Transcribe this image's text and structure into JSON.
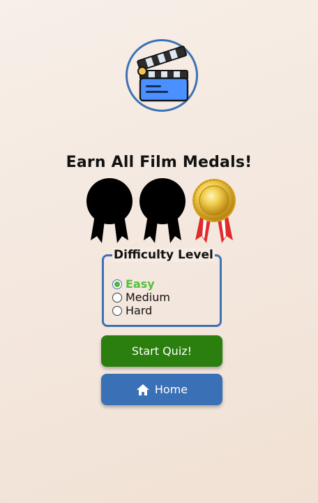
{
  "logo": {
    "icon": "clapperboard-icon",
    "ring_color": "#3d72b4"
  },
  "title": "Earn All Film Medals!",
  "medals": [
    {
      "name": "medal-1",
      "state": "locked"
    },
    {
      "name": "medal-2",
      "state": "locked"
    },
    {
      "name": "medal-3",
      "state": "earned",
      "color": "#e2b83a"
    }
  ],
  "difficulty": {
    "legend": "Difficulty Level",
    "selected": "Easy",
    "options": [
      {
        "label": "Easy",
        "checked": true
      },
      {
        "label": "Medium",
        "checked": false
      },
      {
        "label": "Hard",
        "checked": false
      }
    ]
  },
  "buttons": {
    "start": {
      "label": "Start Quiz!",
      "color": "#2a7f0e"
    },
    "home": {
      "label": "Home",
      "icon": "home-icon",
      "color": "#3a70b5"
    }
  }
}
